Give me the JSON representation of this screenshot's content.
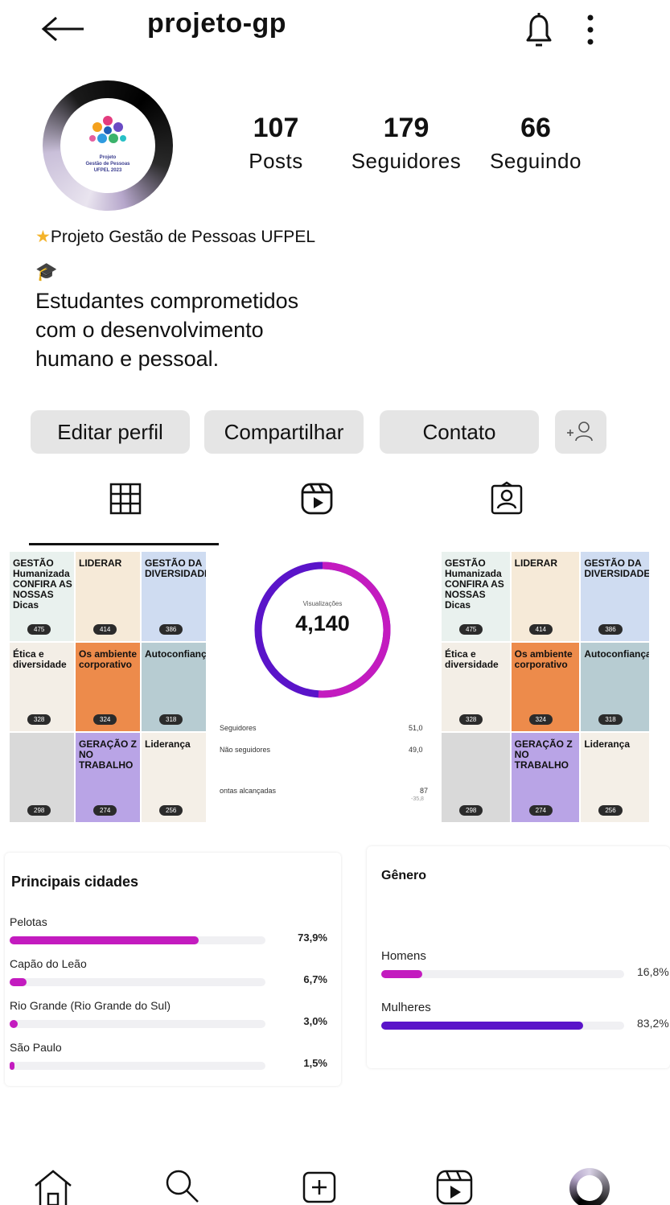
{
  "header": {
    "title": "projeto-gp",
    "back_icon": "arrow-left-icon",
    "bell_icon": "bell-icon",
    "menu_icon": "more-vertical-icon"
  },
  "profile": {
    "avatar_lines": [
      "Projeto",
      "Gestão de Pessoas",
      "UFPEL 2023"
    ],
    "stats": [
      {
        "value": "107",
        "label": "Posts"
      },
      {
        "value": "179",
        "label": "Seguidores"
      },
      {
        "value": "66",
        "label": "Seguindo"
      }
    ],
    "name": "Projeto Gestão de Pessoas UFPEL",
    "bio_lines": [
      "Estudantes comprometidos",
      "com o desenvolvimento",
      "humano e pessoal."
    ]
  },
  "actions": {
    "edit": "Editar perfil",
    "share": "Compartilhar",
    "contact": "Contato",
    "add_icon": "add-person-icon"
  },
  "tabs": [
    {
      "name": "grid",
      "icon": "grid-icon",
      "active": true
    },
    {
      "name": "reels",
      "icon": "reels-icon",
      "active": false
    },
    {
      "name": "tagged",
      "icon": "tagged-icon",
      "active": false
    }
  ],
  "post_grid": {
    "cells": [
      {
        "text": "GESTÃO Humanizada CONFIRA AS NOSSAS Dicas",
        "badge": "475",
        "bg": "#e9f1ee"
      },
      {
        "text": "LIDERAR",
        "badge": "414",
        "bg": "#f6ead8"
      },
      {
        "text": "GESTÃO DA DIVERSIDADE",
        "badge": "386",
        "bg": "#cfdcf1"
      },
      {
        "text": "Ética e diversidade",
        "badge": "328",
        "bg": "#f3eee6"
      },
      {
        "text": "Os ambiente corporativo",
        "badge": "324",
        "bg": "#ed8b4b"
      },
      {
        "text": "Autoconfiança",
        "badge": "318",
        "bg": "#b7ccd2"
      },
      {
        "text": "",
        "badge": "298",
        "bg": "#d9d9d9"
      },
      {
        "text": "GERAÇÃO Z NO TRABALHO",
        "badge": "274",
        "bg": "#b9a4e6"
      },
      {
        "text": "Liderança",
        "badge": "256",
        "bg": "#f4efe7"
      }
    ]
  },
  "insights": {
    "donut_label": "Visualizações",
    "donut_value": "4,140",
    "rows": [
      {
        "label": "Seguidores",
        "value": "51,0"
      },
      {
        "label": "Não seguidores",
        "value": "49,0"
      },
      {
        "label": "ontas alcançadas",
        "value": "87",
        "sub": "-35,8"
      }
    ]
  },
  "cities": {
    "title": "Principais cidades",
    "items": [
      {
        "name": "Pelotas",
        "pct": "73,9%",
        "fraction": 0.739
      },
      {
        "name": "Capão do Leão",
        "pct": "6,7%",
        "fraction": 0.067
      },
      {
        "name": "Rio Grande (Rio Grande do Sul)",
        "pct": "3,0%",
        "fraction": 0.03
      },
      {
        "name": "São Paulo",
        "pct": "1,5%",
        "fraction": 0.015
      }
    ]
  },
  "gender": {
    "title": "Gênero",
    "items": [
      {
        "name": "Homens",
        "pct": "16,8%",
        "fraction": 0.168
      },
      {
        "name": "Mulheres",
        "pct": "83,2%",
        "fraction": 0.832
      }
    ]
  },
  "colors": {
    "magenta": "#c31bbf",
    "purple": "#5a14c9",
    "track": "#f0f0f3"
  },
  "bottom_nav": [
    "home-icon",
    "search-icon",
    "create-icon",
    "reels-icon",
    "profile-avatar-icon"
  ]
}
